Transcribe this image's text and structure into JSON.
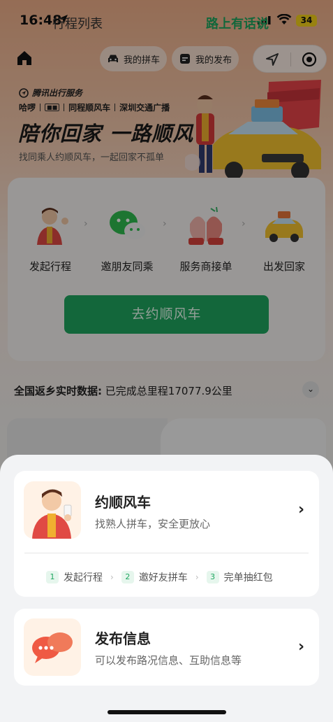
{
  "status_bar": {
    "time": "16:48",
    "battery": "34"
  },
  "nav": {
    "my_carpool": "我的拼车",
    "my_posts": "我的发布"
  },
  "banner": {
    "service": "腾讯出行服务",
    "partners": [
      "哈啰",
      "同程顺风车",
      "深圳交通广播"
    ],
    "headline": "陪你回家 一路顺风",
    "subline": "找同乘人约顺风车，一起回家不孤单"
  },
  "steps": [
    {
      "label": "发起行程"
    },
    {
      "label": "邀朋友同乘"
    },
    {
      "label": "服务商接单"
    },
    {
      "label": "出发回家"
    }
  ],
  "cta": {
    "label": "去约顺风车"
  },
  "stats": {
    "prefix": "全国返乡实时数据:",
    "value": "已完成总里程17077.9公里"
  },
  "tabs": {
    "left": "行程列表",
    "right": "路上有话说"
  },
  "sheet": {
    "option1": {
      "title": "约顺风车",
      "subtitle": "找熟人拼车，安全更放心",
      "steps": [
        {
          "num": "1",
          "label": "发起行程"
        },
        {
          "num": "2",
          "label": "邀好友拼车"
        },
        {
          "num": "3",
          "label": "完单抽红包"
        }
      ]
    },
    "option2": {
      "title": "发布信息",
      "subtitle": "可以发布路况信息、互助信息等"
    }
  },
  "colors": {
    "accent_green": "#1fa760",
    "battery_yellow": "#f6d21a"
  }
}
